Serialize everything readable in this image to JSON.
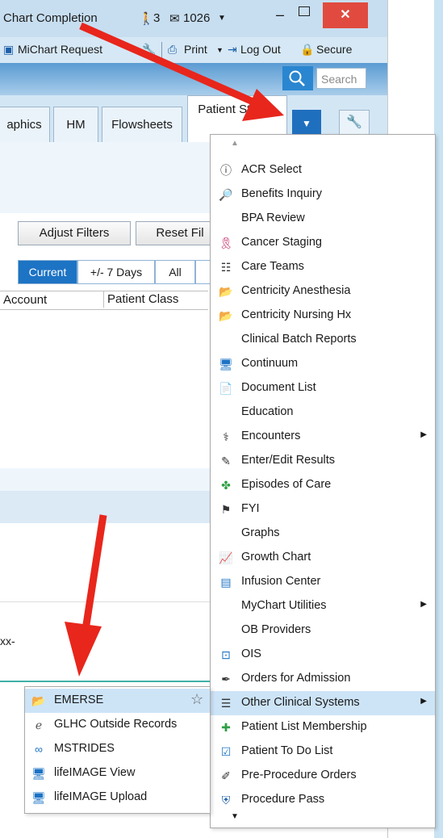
{
  "titlebar": {
    "title": "Chart Completion",
    "inbasket_count": "3",
    "mail_count": "1026",
    "close": "✕"
  },
  "toolbar": {
    "michart_request": "MiChart Request",
    "print": "Print",
    "logout": "Log Out",
    "secure": "Secure"
  },
  "search": {
    "placeholder": "Search"
  },
  "tabs": [
    {
      "label": "aphics"
    },
    {
      "label": "HM"
    },
    {
      "label": "Flowsheets"
    },
    {
      "label": "Patient Station"
    }
  ],
  "filters": {
    "adjust": "Adjust Filters",
    "reset": "Reset Fil"
  },
  "range": {
    "current": "Current",
    "seven_days": "+/- 7 Days",
    "all": "All"
  },
  "columns": {
    "account": "Account",
    "patient_class": "Patient Class"
  },
  "row_text": "xx-",
  "menu_items": [
    {
      "label": "ACR Select",
      "icon": "info-icon"
    },
    {
      "label": "Benefits Inquiry",
      "icon": "inquiry-icon"
    },
    {
      "label": "BPA Review",
      "icon": ""
    },
    {
      "label": "Cancer Staging",
      "icon": "ribbon-icon"
    },
    {
      "label": "Care Teams",
      "icon": "team-icon"
    },
    {
      "label": "Centricity Anesthesia",
      "icon": "folder-icon"
    },
    {
      "label": "Centricity Nursing Hx",
      "icon": "folder-icon"
    },
    {
      "label": "Clinical Batch Reports",
      "icon": ""
    },
    {
      "label": "Continuum",
      "icon": "monitor-person-icon"
    },
    {
      "label": "Document List",
      "icon": "document-icon"
    },
    {
      "label": "Education",
      "icon": ""
    },
    {
      "label": "Encounters",
      "icon": "stethoscope-icon",
      "submenu": true
    },
    {
      "label": "Enter/Edit Results",
      "icon": "pencil-icon"
    },
    {
      "label": "Episodes of Care",
      "icon": "episodes-icon"
    },
    {
      "label": "FYI",
      "icon": "flag-icon"
    },
    {
      "label": "Graphs",
      "icon": ""
    },
    {
      "label": "Growth Chart",
      "icon": "growth-icon"
    },
    {
      "label": "Infusion Center",
      "icon": "infusion-icon"
    },
    {
      "label": "MyChart Utilities",
      "icon": "",
      "submenu": true
    },
    {
      "label": "OB Providers",
      "icon": ""
    },
    {
      "label": "OIS",
      "icon": "ois-icon"
    },
    {
      "label": "Orders for Admission",
      "icon": "pen-icon"
    },
    {
      "label": "Other Clinical Systems",
      "icon": "list-icon",
      "submenu": true,
      "highlight": true
    },
    {
      "label": "Patient List Membership",
      "icon": "plus-icon"
    },
    {
      "label": "Patient To Do List",
      "icon": "todo-icon"
    },
    {
      "label": "Pre-Procedure Orders",
      "icon": "procedure-icon"
    },
    {
      "label": "Procedure Pass",
      "icon": "shield-icon"
    }
  ],
  "submenu_items": [
    {
      "label": "EMERSE",
      "icon": "folder-icon",
      "highlight": true
    },
    {
      "label": "GLHC Outside Records",
      "icon": "glhc-icon"
    },
    {
      "label": "MSTRIDES",
      "icon": "link-icon"
    },
    {
      "label": "lifeIMAGE View",
      "icon": "monitor-person-icon"
    },
    {
      "label": "lifeIMAGE Upload",
      "icon": "monitor-person-icon"
    }
  ],
  "colors": {
    "accent": "#1d73c4",
    "highlight": "#cde4f7",
    "arrow": "#e8261c",
    "close": "#e14b3f"
  }
}
